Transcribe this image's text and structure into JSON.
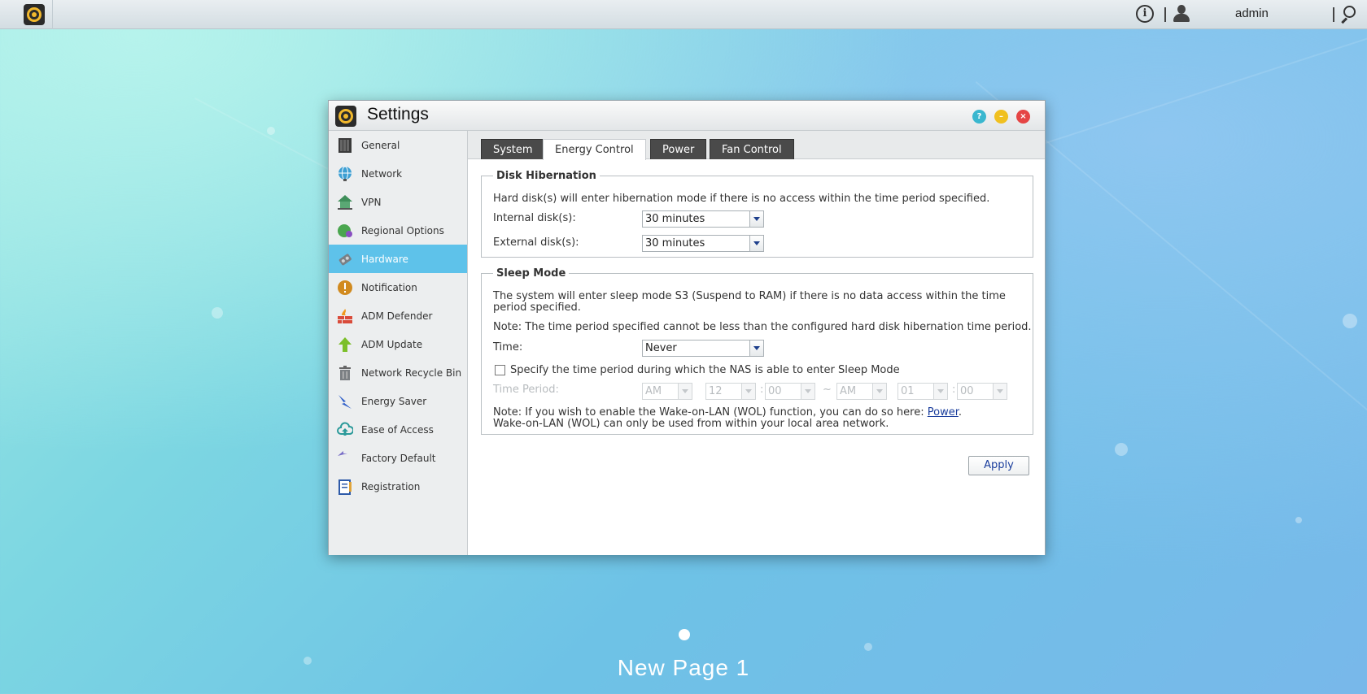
{
  "topbar": {
    "username": "admin",
    "info_glyph": "i"
  },
  "window": {
    "title": "Settings",
    "help_glyph": "?"
  },
  "sidebar": {
    "items": [
      {
        "label": "General",
        "icon": "nas-device-icon"
      },
      {
        "label": "Network",
        "icon": "globe-icon"
      },
      {
        "label": "VPN",
        "icon": "vpn-house-icon"
      },
      {
        "label": "Regional Options",
        "icon": "globe-pin-icon"
      },
      {
        "label": "Hardware",
        "icon": "hardware-chip-icon",
        "active": true
      },
      {
        "label": "Notification",
        "icon": "exclamation-icon"
      },
      {
        "label": "ADM Defender",
        "icon": "firewall-icon"
      },
      {
        "label": "ADM Update",
        "icon": "up-arrow-icon"
      },
      {
        "label": "Network Recycle Bin",
        "icon": "trash-bin-icon"
      },
      {
        "label": "Energy Saver",
        "icon": "lightning-icon"
      },
      {
        "label": "Ease of Access",
        "icon": "cloud-upload-icon"
      },
      {
        "label": "Factory Default",
        "icon": "undo-arrow-icon"
      },
      {
        "label": "Registration",
        "icon": "clipboard-icon"
      }
    ]
  },
  "tabs": [
    "System",
    "Energy Control",
    "Power",
    "Fan Control"
  ],
  "active_tab": "Energy Control",
  "disk_hibernation": {
    "legend": "Disk Hibernation",
    "description": "Hard disk(s) will enter hibernation mode if there is no access within the time period specified.",
    "internal_label": "Internal disk(s):",
    "internal_value": "30 minutes",
    "external_label": "External disk(s):",
    "external_value": "30 minutes"
  },
  "sleep_mode": {
    "legend": "Sleep Mode",
    "description_line1": "The system will enter sleep mode S3 (Suspend to RAM) if there is no data access within the time",
    "description_line2": "period specified.",
    "note": "Note: The time period specified cannot be less than the configured hard disk hibernation time period.",
    "time_label": "Time:",
    "time_value": "Never",
    "specify_label": "Specify the time period during which the NAS is able to enter Sleep Mode",
    "specify_checked": false,
    "period_label": "Time Period:",
    "period": {
      "start_ampm": "AM",
      "start_hour": "12",
      "start_minute": "00",
      "separator": "~",
      "colon": ":",
      "end_ampm": "AM",
      "end_hour": "01",
      "end_minute": "00"
    },
    "wol_note_prefix": "Note: If you wish to enable the Wake-on-LAN (WOL) function, you can do so here: ",
    "wol_link": "Power",
    "wol_note_suffix": ".",
    "wol_note_line2": "Wake-on-LAN (WOL) can only be used from within your local area network."
  },
  "apply_label": "Apply",
  "desktop": {
    "page_name": "New Page 1"
  },
  "colors": {
    "active_item": "#5ec2ea",
    "tab_dark": "#4a4a4a",
    "link": "#1a3d9c"
  }
}
